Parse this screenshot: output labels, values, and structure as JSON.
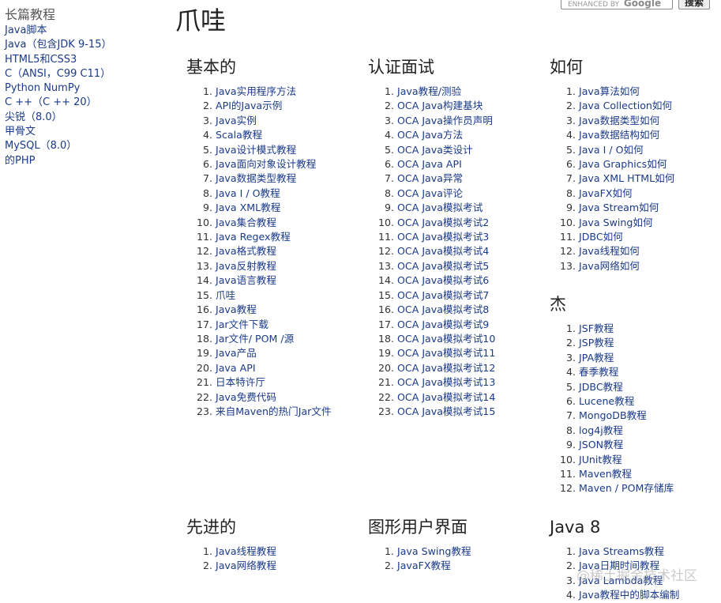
{
  "sidebar": {
    "title": "长篇教程",
    "items": [
      "Java脚本",
      "Java（包含JDK 9-15）",
      "HTML5和CSS3",
      "C（ANSI，C99 C11）",
      "Python NumPy",
      "C ++（C ++ 20）",
      "尖锐（8.0）",
      "甲骨文",
      "MySQL（8.0）",
      "的PHP"
    ]
  },
  "page": {
    "title": "爪哇"
  },
  "search": {
    "placeholder_prefix": "ENHANCED BY",
    "placeholder_brand": "Google",
    "button_label": "搜索"
  },
  "sections": {
    "basic": {
      "heading": "基本的",
      "items": [
        "Java实用程序方法",
        "API的Java示例",
        "Java实例",
        "Scala教程",
        "Java设计模式教程",
        "Java面向对象设计教程",
        "Java数据类型教程",
        "Java I / O教程",
        "Java XML教程",
        "Java集合教程",
        "Java Regex教程",
        "Java格式教程",
        "Java反射教程",
        "Java语言教程",
        "爪哇",
        "Java教程",
        "Jar文件下载",
        "Jar文件/ POM /源",
        "Java产品",
        "Java API",
        "日本特许厅",
        "Java免费代码",
        "来自Maven的热门Jar文件"
      ]
    },
    "cert": {
      "heading": "认证面试",
      "items": [
        "Java教程/测验",
        "OCA Java构建基块",
        "OCA Java操作员声明",
        "OCA Java方法",
        "OCA Java类设计",
        "OCA Java API",
        "OCA Java异常",
        "OCA Java评论",
        "OCA Java模拟考试",
        "OCA Java模拟考试2",
        "OCA Java模拟考试3",
        "OCA Java模拟考试4",
        "OCA Java模拟考试5",
        "OCA Java模拟考试6",
        "OCA Java模拟考试7",
        "OCA Java模拟考试8",
        "OCA Java模拟考试9",
        "OCA Java模拟考试10",
        "OCA Java模拟考试11",
        "OCA Java模拟考试12",
        "OCA Java模拟考试13",
        "OCA Java模拟考试14",
        "OCA Java模拟考试15"
      ]
    },
    "howto": {
      "heading": "如何",
      "items": [
        "Java算法如何",
        "Java Collection如何",
        "Java数据类型如何",
        "Java数据结构如何",
        "Java I / O如何",
        "Java Graphics如何",
        "Java XML HTML如何",
        "JavaFX如何",
        "Java Stream如何",
        "Java Swing如何",
        "JDBC如何",
        "Java线程如何",
        "Java网络如何"
      ]
    },
    "jie": {
      "heading": "杰",
      "items": [
        "JSF教程",
        "JSP教程",
        "JPA教程",
        "春季教程",
        "JDBC教程",
        "Lucene教程",
        "MongoDB教程",
        "log4j教程",
        "JSON教程",
        "JUnit教程",
        "Maven教程",
        "Maven / POM存储库"
      ]
    },
    "advanced": {
      "heading": "先进的",
      "items": [
        "Java线程教程",
        "Java网络教程"
      ]
    },
    "gui": {
      "heading": "图形用户界面",
      "items": [
        "Java Swing教程",
        "JavaFX教程"
      ]
    },
    "java8": {
      "heading": "Java 8",
      "items": [
        "Java Streams教程",
        "Java日期时间教程",
        "Java Lambda教程",
        "Java教程中的脚本编制"
      ]
    }
  },
  "watermark": {
    "text": "@稀土掘金技术社区"
  },
  "colors": {
    "link": "#1a3a8a",
    "heading": "#222222",
    "sidebar_title": "#555555",
    "background": "#ffffff"
  }
}
